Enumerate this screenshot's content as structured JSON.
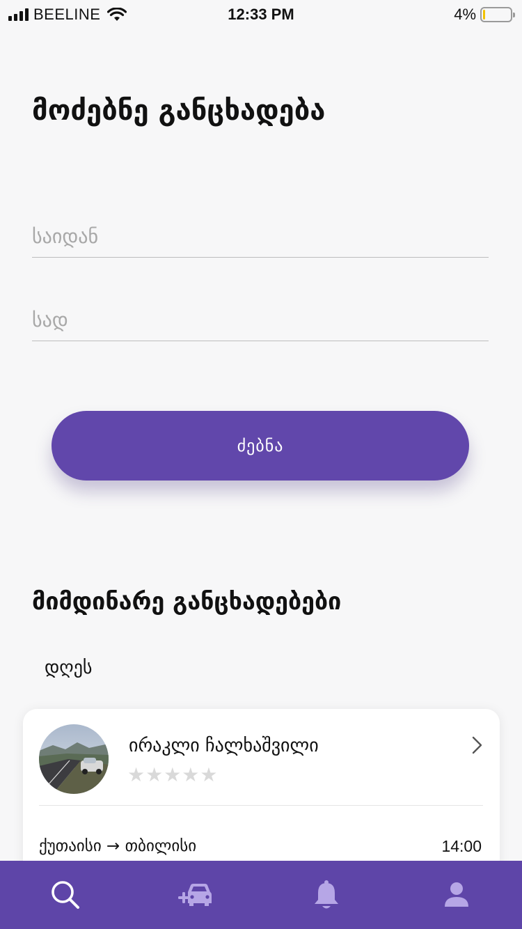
{
  "status_bar": {
    "carrier": "BEELINE",
    "time": "12:33 PM",
    "battery": "4%",
    "battery_level": 0.04
  },
  "search": {
    "title": "მოძებნე განცხადება",
    "from_placeholder": "საიდან",
    "to_placeholder": "სად",
    "button_label": "ძებნა"
  },
  "listings": {
    "section_title": "მიმდინარე განცხადებები",
    "date_label": "დღეს",
    "items": [
      {
        "driver_name": "ირაკლი ჩალხაშვილი",
        "rating_stars": "★★★★★",
        "rating": 0,
        "route": "ქუთაისი → თბილისი",
        "time": "14:00"
      }
    ]
  },
  "tab_bar": {
    "items": [
      {
        "icon": "search-icon",
        "active": true
      },
      {
        "icon": "add-car-icon",
        "active": false
      },
      {
        "icon": "bell-icon",
        "active": false
      },
      {
        "icon": "profile-icon",
        "active": false
      }
    ],
    "colors": {
      "background": "#5e45a8",
      "active": "#ffffff",
      "inactive": "#b6a6e6"
    }
  },
  "colors": {
    "accent": "#6147ab"
  }
}
